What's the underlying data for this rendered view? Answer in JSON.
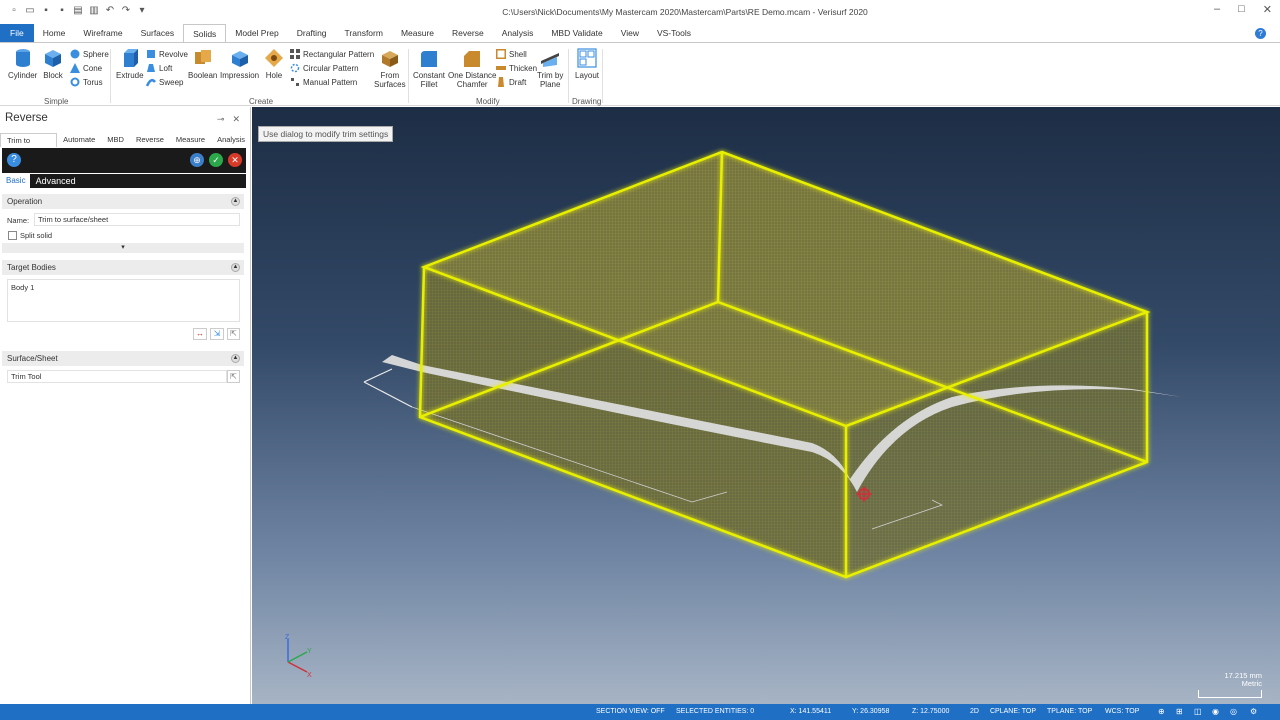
{
  "window": {
    "title": "C:\\Users\\Nick\\Documents\\My Mastercam 2020\\Mastercam\\Parts\\RE Demo.mcam - Verisurf 2020"
  },
  "ribbon_tabs": [
    "File",
    "Home",
    "Wireframe",
    "Surfaces",
    "Solids",
    "Model Prep",
    "Drafting",
    "Transform",
    "Measure",
    "Reverse",
    "Analysis",
    "MBD Validate",
    "View",
    "VS-Tools"
  ],
  "active_tab": "Solids",
  "ribbon": {
    "cylinder": "Cylinder",
    "block": "Block",
    "sphere": "Sphere",
    "cone": "Cone",
    "torus": "Torus",
    "extrude": "Extrude",
    "revolve": "Revolve",
    "loft": "Loft",
    "sweep": "Sweep",
    "boolean": "Boolean",
    "impression": "Impression",
    "hole": "Hole",
    "rect_pattern": "Rectangular Pattern",
    "circ_pattern": "Circular Pattern",
    "manual_pattern": "Manual Pattern",
    "from_surfaces_1": "From",
    "from_surfaces_2": "Surfaces",
    "const_fillet_1": "Constant",
    "const_fillet_2": "Fillet",
    "one_dist_1": "One Distance",
    "one_dist_2": "Chamfer",
    "shell": "Shell",
    "thicken": "Thicken",
    "draft": "Draft",
    "trim_plane_1": "Trim by",
    "trim_plane_2": "Plane",
    "layout": "Layout",
    "groups": {
      "simple": "Simple",
      "create": "Create",
      "modify": "Modify",
      "drawing": "Drawing"
    }
  },
  "panel": {
    "title": "Reverse",
    "tabs": [
      "Trim to Surfa...",
      "Automate",
      "MBD",
      "Reverse",
      "Measure",
      "Analysis"
    ],
    "basic_tab": "Basic",
    "advanced_tab": "Advanced",
    "operation": {
      "header": "Operation",
      "name_label": "Name:",
      "name_value": "Trim to surface/sheet",
      "split_solid": "Split solid"
    },
    "target_bodies": {
      "header": "Target Bodies",
      "items": [
        "Body 1"
      ]
    },
    "surface_sheet": {
      "header": "Surface/Sheet",
      "trim_tool": "Trim Tool"
    }
  },
  "viewport": {
    "hint": "Use dialog to modify trim settings",
    "scale_value": "17.215 mm",
    "scale_unit": "Metric"
  },
  "status_bar": {
    "section_view": "SECTION VIEW: OFF",
    "selected": "SELECTED ENTITIES: 0",
    "x": "X:  141.55411",
    "y": "Y:  26.30958",
    "z": "Z:  12.75000",
    "mode": "2D",
    "cplane": "CPLANE: TOP",
    "tplane": "TPLANE: TOP",
    "wcs": "WCS: TOP"
  },
  "colors": {
    "accent": "#1f6fc5",
    "solid_highlight": "#e8f000",
    "surface": "#d9d9d9"
  }
}
